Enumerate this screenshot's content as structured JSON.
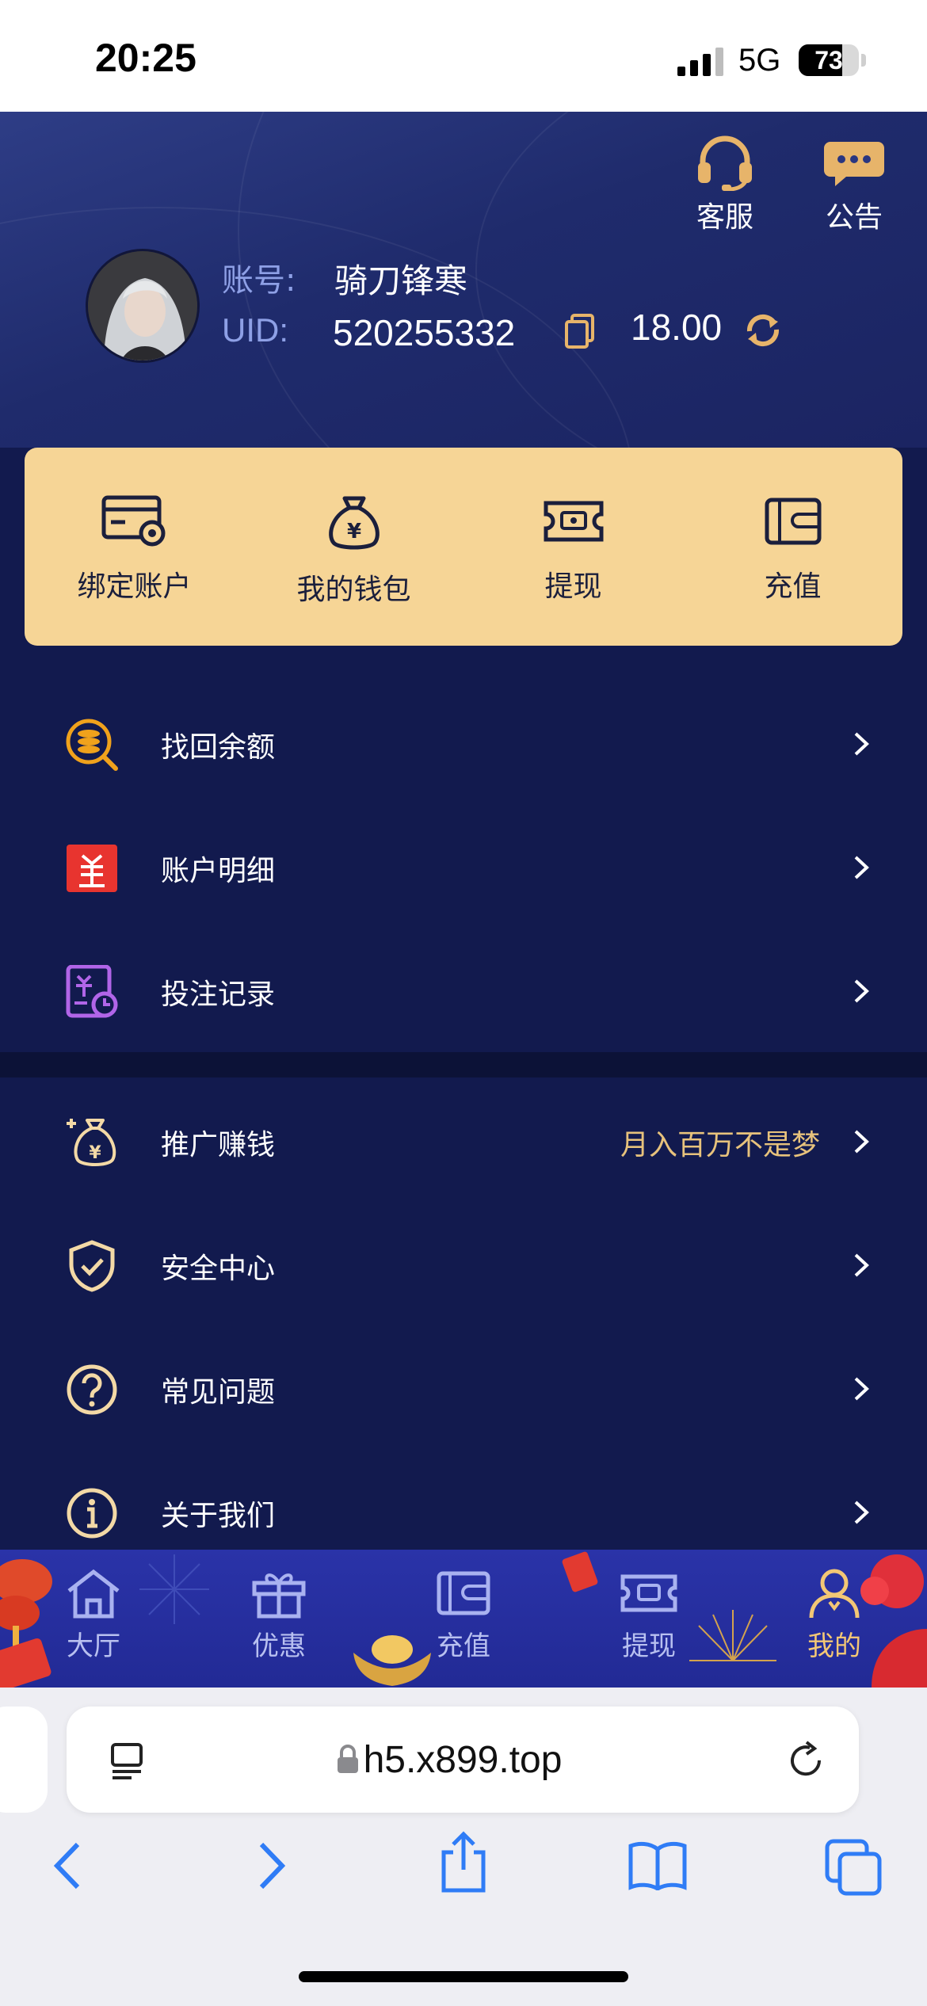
{
  "status_bar": {
    "time": "20:25",
    "network": "5G",
    "battery": "73",
    "battery_level": 0.73
  },
  "header": {
    "actions": [
      {
        "label": "客服",
        "icon": "headset-icon"
      },
      {
        "label": "公告",
        "icon": "message-icon"
      }
    ],
    "account_label": "账号:",
    "account_name": "骑刀锋寒",
    "uid_label": "UID:",
    "uid_value": "520255332",
    "balance": "18.00"
  },
  "wallet": [
    {
      "label": "绑定账户",
      "icon": "bind-card-icon"
    },
    {
      "label": "我的钱包",
      "icon": "money-bag-icon"
    },
    {
      "label": "提现",
      "icon": "withdraw-ticket-icon"
    },
    {
      "label": "充值",
      "icon": "wallet-icon"
    }
  ],
  "menu_group_1": [
    {
      "label": "找回余额",
      "icon": "coin-search-icon"
    },
    {
      "label": "账户明细",
      "icon": "ledger-icon"
    },
    {
      "label": "投注记录",
      "icon": "bet-record-icon"
    }
  ],
  "menu_group_2": [
    {
      "label": "推广赚钱",
      "extra": "月入百万不是梦",
      "icon": "money-bag-plus-icon"
    },
    {
      "label": "安全中心",
      "icon": "shield-check-icon"
    },
    {
      "label": "常见问题",
      "icon": "question-icon"
    },
    {
      "label": "关于我们",
      "icon": "info-icon"
    }
  ],
  "tabbar": [
    {
      "label": "大厅",
      "icon": "home-icon"
    },
    {
      "label": "优惠",
      "icon": "gift-icon"
    },
    {
      "label": "充值",
      "icon": "wallet-icon"
    },
    {
      "label": "提现",
      "icon": "withdraw-icon"
    },
    {
      "label": "我的",
      "icon": "user-icon",
      "active": true
    }
  ],
  "browser": {
    "url": "h5.x899.top"
  },
  "colors": {
    "accent_gold": "#f6d596",
    "page_bg": "#121a4e",
    "tab_active": "#f3c775"
  }
}
